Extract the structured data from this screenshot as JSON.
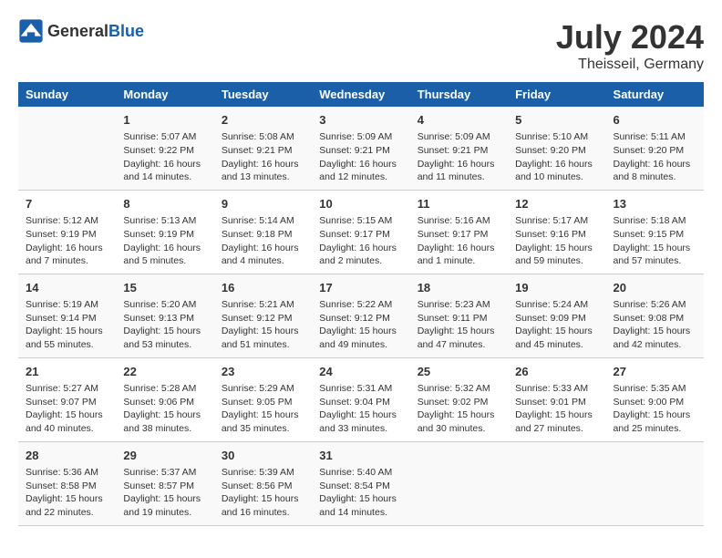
{
  "logo": {
    "text_general": "General",
    "text_blue": "Blue"
  },
  "title": "July 2024",
  "subtitle": "Theisseil, Germany",
  "days_header": [
    "Sunday",
    "Monday",
    "Tuesday",
    "Wednesday",
    "Thursday",
    "Friday",
    "Saturday"
  ],
  "weeks": [
    [
      {
        "day": "",
        "info": ""
      },
      {
        "day": "1",
        "info": "Sunrise: 5:07 AM\nSunset: 9:22 PM\nDaylight: 16 hours\nand 14 minutes."
      },
      {
        "day": "2",
        "info": "Sunrise: 5:08 AM\nSunset: 9:21 PM\nDaylight: 16 hours\nand 13 minutes."
      },
      {
        "day": "3",
        "info": "Sunrise: 5:09 AM\nSunset: 9:21 PM\nDaylight: 16 hours\nand 12 minutes."
      },
      {
        "day": "4",
        "info": "Sunrise: 5:09 AM\nSunset: 9:21 PM\nDaylight: 16 hours\nand 11 minutes."
      },
      {
        "day": "5",
        "info": "Sunrise: 5:10 AM\nSunset: 9:20 PM\nDaylight: 16 hours\nand 10 minutes."
      },
      {
        "day": "6",
        "info": "Sunrise: 5:11 AM\nSunset: 9:20 PM\nDaylight: 16 hours\nand 8 minutes."
      }
    ],
    [
      {
        "day": "7",
        "info": "Sunrise: 5:12 AM\nSunset: 9:19 PM\nDaylight: 16 hours\nand 7 minutes."
      },
      {
        "day": "8",
        "info": "Sunrise: 5:13 AM\nSunset: 9:19 PM\nDaylight: 16 hours\nand 5 minutes."
      },
      {
        "day": "9",
        "info": "Sunrise: 5:14 AM\nSunset: 9:18 PM\nDaylight: 16 hours\nand 4 minutes."
      },
      {
        "day": "10",
        "info": "Sunrise: 5:15 AM\nSunset: 9:17 PM\nDaylight: 16 hours\nand 2 minutes."
      },
      {
        "day": "11",
        "info": "Sunrise: 5:16 AM\nSunset: 9:17 PM\nDaylight: 16 hours\nand 1 minute."
      },
      {
        "day": "12",
        "info": "Sunrise: 5:17 AM\nSunset: 9:16 PM\nDaylight: 15 hours\nand 59 minutes."
      },
      {
        "day": "13",
        "info": "Sunrise: 5:18 AM\nSunset: 9:15 PM\nDaylight: 15 hours\nand 57 minutes."
      }
    ],
    [
      {
        "day": "14",
        "info": "Sunrise: 5:19 AM\nSunset: 9:14 PM\nDaylight: 15 hours\nand 55 minutes."
      },
      {
        "day": "15",
        "info": "Sunrise: 5:20 AM\nSunset: 9:13 PM\nDaylight: 15 hours\nand 53 minutes."
      },
      {
        "day": "16",
        "info": "Sunrise: 5:21 AM\nSunset: 9:12 PM\nDaylight: 15 hours\nand 51 minutes."
      },
      {
        "day": "17",
        "info": "Sunrise: 5:22 AM\nSunset: 9:12 PM\nDaylight: 15 hours\nand 49 minutes."
      },
      {
        "day": "18",
        "info": "Sunrise: 5:23 AM\nSunset: 9:11 PM\nDaylight: 15 hours\nand 47 minutes."
      },
      {
        "day": "19",
        "info": "Sunrise: 5:24 AM\nSunset: 9:09 PM\nDaylight: 15 hours\nand 45 minutes."
      },
      {
        "day": "20",
        "info": "Sunrise: 5:26 AM\nSunset: 9:08 PM\nDaylight: 15 hours\nand 42 minutes."
      }
    ],
    [
      {
        "day": "21",
        "info": "Sunrise: 5:27 AM\nSunset: 9:07 PM\nDaylight: 15 hours\nand 40 minutes."
      },
      {
        "day": "22",
        "info": "Sunrise: 5:28 AM\nSunset: 9:06 PM\nDaylight: 15 hours\nand 38 minutes."
      },
      {
        "day": "23",
        "info": "Sunrise: 5:29 AM\nSunset: 9:05 PM\nDaylight: 15 hours\nand 35 minutes."
      },
      {
        "day": "24",
        "info": "Sunrise: 5:31 AM\nSunset: 9:04 PM\nDaylight: 15 hours\nand 33 minutes."
      },
      {
        "day": "25",
        "info": "Sunrise: 5:32 AM\nSunset: 9:02 PM\nDaylight: 15 hours\nand 30 minutes."
      },
      {
        "day": "26",
        "info": "Sunrise: 5:33 AM\nSunset: 9:01 PM\nDaylight: 15 hours\nand 27 minutes."
      },
      {
        "day": "27",
        "info": "Sunrise: 5:35 AM\nSunset: 9:00 PM\nDaylight: 15 hours\nand 25 minutes."
      }
    ],
    [
      {
        "day": "28",
        "info": "Sunrise: 5:36 AM\nSunset: 8:58 PM\nDaylight: 15 hours\nand 22 minutes."
      },
      {
        "day": "29",
        "info": "Sunrise: 5:37 AM\nSunset: 8:57 PM\nDaylight: 15 hours\nand 19 minutes."
      },
      {
        "day": "30",
        "info": "Sunrise: 5:39 AM\nSunset: 8:56 PM\nDaylight: 15 hours\nand 16 minutes."
      },
      {
        "day": "31",
        "info": "Sunrise: 5:40 AM\nSunset: 8:54 PM\nDaylight: 15 hours\nand 14 minutes."
      },
      {
        "day": "",
        "info": ""
      },
      {
        "day": "",
        "info": ""
      },
      {
        "day": "",
        "info": ""
      }
    ]
  ]
}
